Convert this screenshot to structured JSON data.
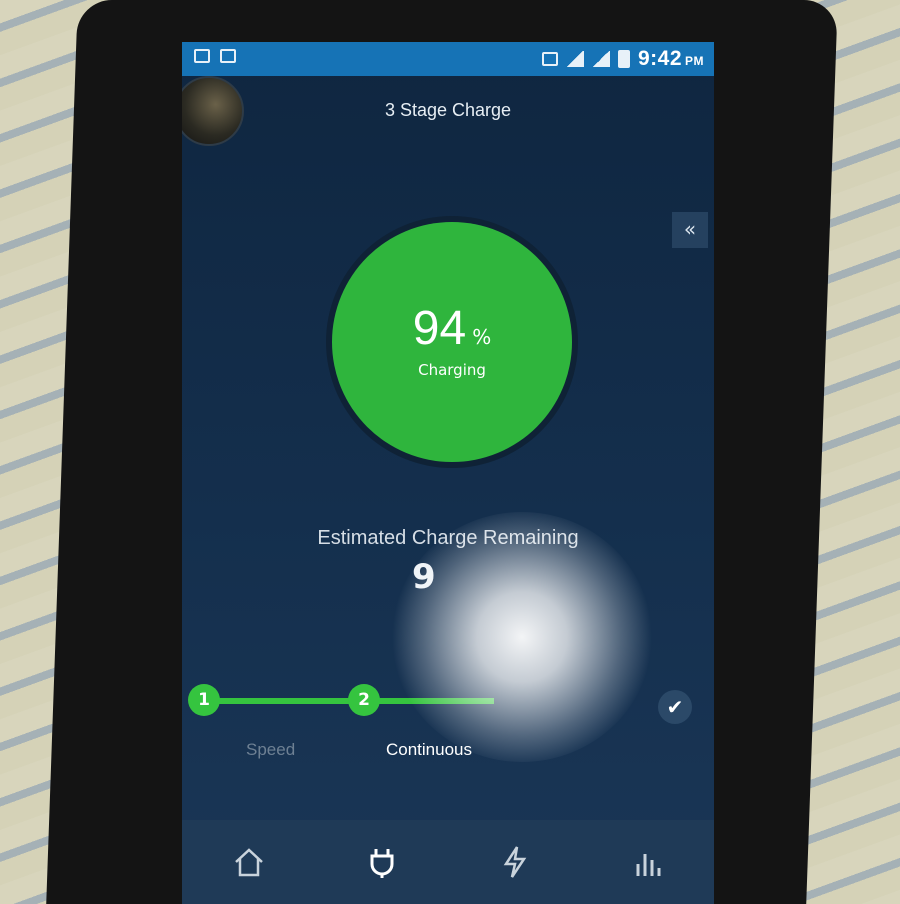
{
  "status_bar": {
    "time": "9:42",
    "ampm": "PM"
  },
  "header": {
    "title": "3 Stage Charge",
    "collapse_icon": "double-chevron-left-icon"
  },
  "gauge": {
    "percent": "94",
    "unit": "%",
    "status": "Charging",
    "level": 0.94,
    "color": "#2fb53d"
  },
  "estimate": {
    "label": "Estimated Charge Remaining",
    "value": "9"
  },
  "stages": [
    {
      "number": "1",
      "label": "Speed",
      "state": "done"
    },
    {
      "number": "2",
      "label": "Continuous",
      "state": "active"
    },
    {
      "icon": "check-icon",
      "state": "pending"
    }
  ],
  "bottom_nav": [
    {
      "name": "home",
      "icon": "home-icon"
    },
    {
      "name": "charge",
      "icon": "plug-icon",
      "active": true
    },
    {
      "name": "boost",
      "icon": "lightning-icon"
    },
    {
      "name": "stats",
      "icon": "bar-chart-icon"
    }
  ],
  "colors": {
    "accent_green": "#35c43f",
    "status_bar": "#1673b6",
    "screen_bg": "#142f4d"
  }
}
